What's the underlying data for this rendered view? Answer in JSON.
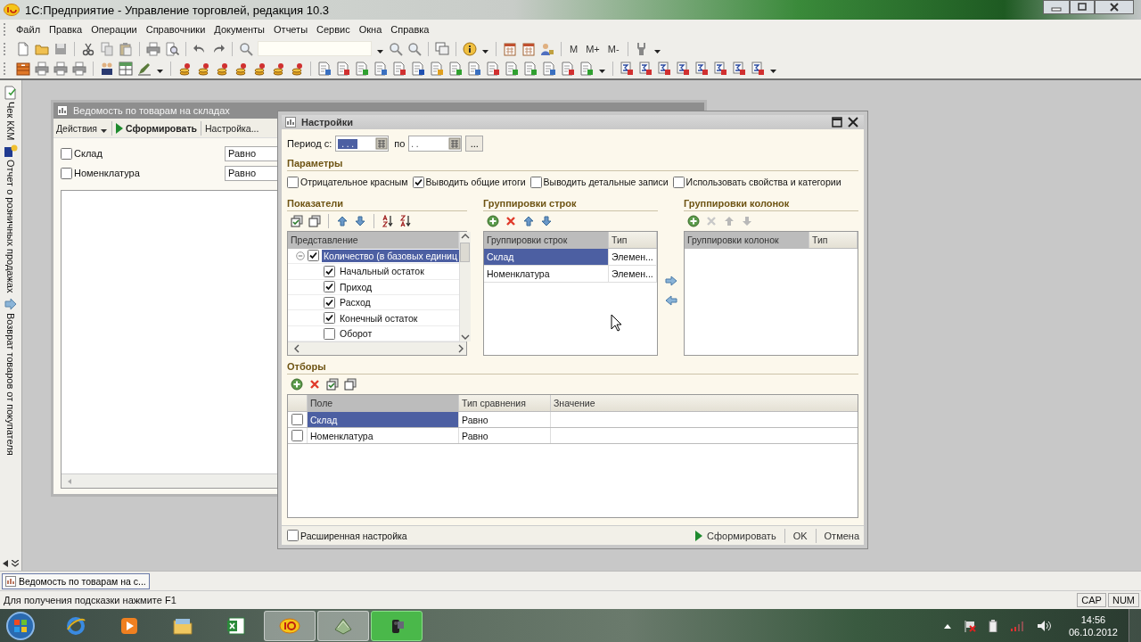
{
  "window": {
    "title": "1С:Предприятие - Управление торговлей, редакция 10.3"
  },
  "menu": [
    {
      "label": "Файл"
    },
    {
      "label": "Правка"
    },
    {
      "label": "Операции"
    },
    {
      "label": "Справочники"
    },
    {
      "label": "Документы"
    },
    {
      "label": "Отчеты"
    },
    {
      "label": "Сервис"
    },
    {
      "label": "Окна"
    },
    {
      "label": "Справка"
    }
  ],
  "toolbar": {
    "text_buttons": [
      "M",
      "M+",
      "M-"
    ]
  },
  "side_panel": {
    "items": [
      {
        "label": "Чек ККМ"
      },
      {
        "label": "Отчет о розничных продажах"
      },
      {
        "label": "Возврат товаров от покупателя"
      }
    ]
  },
  "report_window": {
    "title": "Ведомость по товарам на складах",
    "actions": [
      {
        "label": "Действия",
        "kind": "menu"
      },
      {
        "label": "Сформировать",
        "kind": "run"
      },
      {
        "label": "Настройка...",
        "kind": "plain"
      }
    ],
    "filters": [
      {
        "label": "Склад",
        "checked": false,
        "comparison": "Равно"
      },
      {
        "label": "Номенклатура",
        "checked": false,
        "comparison": "Равно"
      }
    ]
  },
  "settings": {
    "title": "Настройки",
    "period_label": "Период с:",
    "period_from": ". . .",
    "to_label": "по",
    "period_to": ". .",
    "more_button": "...",
    "parameters_title": "Параметры",
    "options": [
      {
        "label": "Отрицательное красным",
        "checked": false
      },
      {
        "label": "Выводить общие итоги",
        "checked": true
      },
      {
        "label": "Выводить детальные записи",
        "checked": false
      },
      {
        "label": "Использовать свойства и категории",
        "checked": false
      }
    ],
    "indicators": {
      "title": "Показатели",
      "column": "Представление",
      "items": [
        {
          "label": "Количество (в базовых единиц",
          "checked": true,
          "expanded": true,
          "selected": true,
          "children": [
            {
              "label": "Начальный остаток",
              "checked": true,
              "selected": false
            },
            {
              "label": "Приход",
              "checked": true,
              "selected": false
            },
            {
              "label": "Расход",
              "checked": true,
              "selected": false
            },
            {
              "label": "Конечный остаток",
              "checked": true,
              "selected": false
            },
            {
              "label": "Оборот",
              "checked": false,
              "selected": false
            }
          ]
        }
      ]
    },
    "row_groupings": {
      "title": "Группировки строк",
      "columns": [
        "Группировки строк",
        "Тип"
      ],
      "rows": [
        {
          "cells": [
            "Склад",
            "Элемен..."
          ],
          "selected": true
        },
        {
          "cells": [
            "Номенклатура",
            "Элемен..."
          ],
          "selected": false
        }
      ]
    },
    "column_groupings": {
      "title": "Группировки колонок",
      "columns": [
        "Группировки колонок",
        "Тип"
      ]
    },
    "filters": {
      "title": "Отборы",
      "columns": [
        "Поле",
        "Тип сравнения",
        "Значение"
      ],
      "rows": [
        {
          "checked": false,
          "field": "Склад",
          "comparison": "Равно",
          "selected": true
        },
        {
          "checked": false,
          "field": "Номенклатура",
          "comparison": "Равно",
          "selected": false
        }
      ]
    },
    "extended": {
      "label": "Расширенная настройка",
      "checked": false
    },
    "buttons": [
      {
        "label": "Сформировать",
        "kind": "run"
      },
      {
        "label": "OK",
        "kind": "plain"
      },
      {
        "label": "Отмена",
        "kind": "plain"
      }
    ]
  },
  "window_tabs": [
    {
      "label": "Ведомость по товарам на с...",
      "selected": true
    }
  ],
  "status_bar": {
    "hint": "Для получения подсказки нажмите F1",
    "indicators": [
      "CAP",
      "NUM"
    ]
  },
  "taskbar": {
    "time": "14:56",
    "date": "06.10.2012"
  }
}
